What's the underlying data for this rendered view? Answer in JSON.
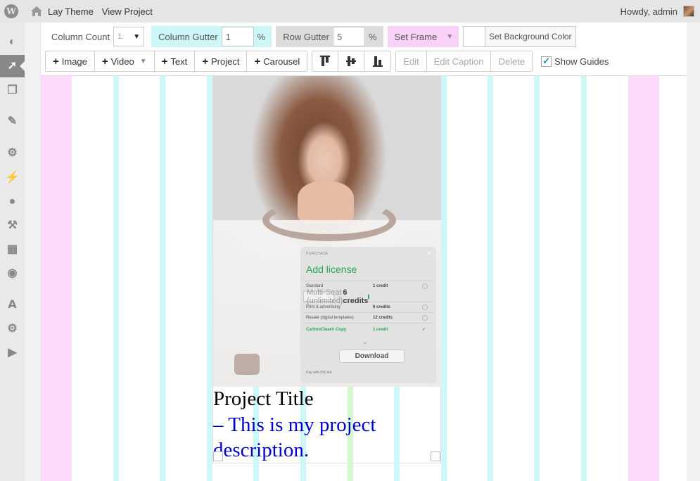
{
  "adminbar": {
    "site_name": "Lay Theme",
    "view_project": "View Project",
    "howdy": "Howdy, admin"
  },
  "sidemenu": {
    "items": [
      "dashboard",
      "posts",
      "pages",
      "appearance",
      "media",
      "plugins",
      "users",
      "tools",
      "settings",
      "visibility",
      "typography",
      "gear",
      "play"
    ],
    "active": "posts"
  },
  "toolbar": {
    "column_count_label": "Column Count",
    "column_count_value": "1.",
    "column_gutter_label": "Column Gutter",
    "column_gutter_value": "1",
    "column_gutter_unit": "%",
    "row_gutter_label": "Row Gutter",
    "row_gutter_value": "5",
    "row_gutter_unit": "%",
    "set_frame_label": "Set Frame",
    "set_bg_label": "Set Background Color",
    "add_buttons": {
      "image": "Image",
      "video": "Video",
      "text": "Text",
      "project": "Project",
      "carousel": "Carousel"
    },
    "edit_buttons": {
      "edit": "Edit",
      "edit_caption": "Edit Caption",
      "delete": "Delete"
    },
    "show_guides_label": "Show Guides",
    "show_guides_checked": true
  },
  "license_widget": {
    "header": "PURCHASE",
    "title": "Add license",
    "rows": [
      {
        "name": "Standard",
        "credits": "1 credit",
        "selected": false
      },
      {
        "name": "Multi-Seat (unlimited)",
        "credits": "6 credits",
        "selected": true
      },
      {
        "name": "Print & advertising",
        "credits": "6 credits",
        "selected": false
      },
      {
        "name": "Resale (digital templates)",
        "credits": "12 credits",
        "selected": false
      }
    ],
    "addon": {
      "name": "CarbonClear® Copy",
      "credits": "1 credit"
    },
    "download_label": "Download",
    "pay_label": "Pay with BitCoin"
  },
  "project": {
    "title": "Project Title",
    "description": "– This is my project description."
  },
  "colors": {
    "guide_pink": "#fcdafc",
    "guide_cyan": "#cdf8fa",
    "gutter_cyan_bg": "#ccf6f8",
    "frame_pink_bg": "#f8d0f8",
    "description_blue": "#0000cc",
    "license_green": "#23a455"
  }
}
